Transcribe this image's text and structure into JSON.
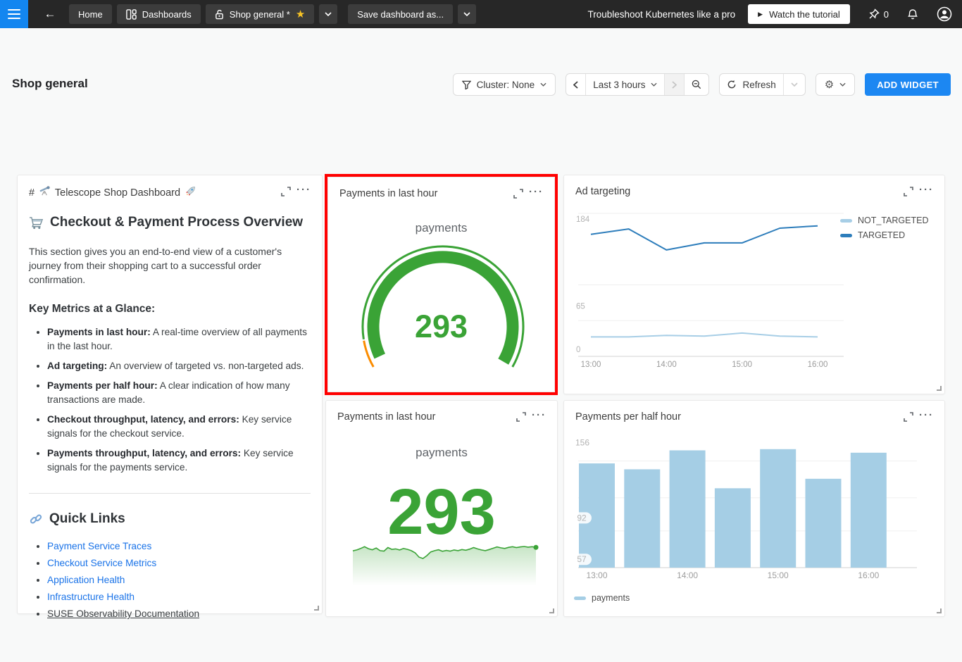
{
  "navbar": {
    "tabs": [
      {
        "label": "Home"
      },
      {
        "label": "Dashboards",
        "icon": "dashboards-icon"
      },
      {
        "label": "Shop general *",
        "icon": "lock-open-icon",
        "star_icon": "star-icon",
        "starred": true
      }
    ],
    "save_button_label": "Save dashboard as...",
    "promo_text": "Troubleshoot Kubernetes like a pro",
    "tutorial_button_label": "Watch the tutorial",
    "pin_count": "0",
    "accent_color": "#1386f0"
  },
  "header": {
    "title": "Shop general",
    "cluster_filter_label": "Cluster: None",
    "time_range_label": "Last 3 hours",
    "refresh_label": "Refresh",
    "add_widget_label": "ADD WIDGET",
    "add_widget_color": "#1c87f2"
  },
  "markdown_widget": {
    "title_hash": "#",
    "title_text": "Telescope Shop Dashboard",
    "title_icons": [
      "telescope-icon",
      "rocket-icon"
    ],
    "heading_icon": "cart-icon",
    "heading": "Checkout & Payment Process Overview",
    "intro": "This section gives you an end-to-end view of a customer's journey from their shopping cart to a successful order confirmation.",
    "metrics_heading": "Key Metrics at a Glance:",
    "metrics": [
      {
        "term": "Payments in last hour:",
        "desc": "A real-time overview of all payments in the last hour."
      },
      {
        "term": "Ad targeting:",
        "desc": "An overview of targeted vs. non-targeted ads."
      },
      {
        "term": "Payments per half hour:",
        "desc": "A clear indication of how many transactions are made."
      },
      {
        "term": "Checkout throughput, latency, and errors:",
        "desc": "Key service signals for the checkout service."
      },
      {
        "term": "Payments throughput, latency, and errors:",
        "desc": "Key service signals for the payments service."
      }
    ],
    "links_heading_icon": "link-icon",
    "links_heading": "Quick Links",
    "links": [
      {
        "label": "Payment Service Traces",
        "style": "link"
      },
      {
        "label": "Checkout Service Metrics",
        "style": "link"
      },
      {
        "label": "Application Health",
        "style": "link"
      },
      {
        "label": "Infrastructure Health",
        "style": "link"
      },
      {
        "label": "SUSE Observability Documentation",
        "style": "plain-underline"
      }
    ]
  },
  "annotation": {
    "type": "highlight-box",
    "color": "#ff0000",
    "target": "Payments in last hour gauge widget"
  },
  "chart_data": [
    {
      "id": "gauge-payments",
      "type": "gauge",
      "widget_title": "Payments in last hour",
      "series_label": "payments",
      "value": 293,
      "value_display": "293",
      "gauge_color": "#3aa336",
      "threshold_color": "#fb8c00",
      "sweep_deg": 240,
      "threshold_sweep_deg": 20
    },
    {
      "id": "ad-targeting",
      "type": "line",
      "title": "Ad targeting",
      "x": [
        "13:00",
        "13:30",
        "14:00",
        "14:30",
        "15:00",
        "15:30",
        "16:00"
      ],
      "x_tick_labels": [
        "13:00",
        "14:00",
        "15:00",
        "16:00"
      ],
      "series": [
        {
          "name": "NOT_TARGETED",
          "color": "#a7cee6",
          "values": [
            25,
            25,
            27,
            26,
            30,
            26,
            25
          ]
        },
        {
          "name": "TARGETED",
          "color": "#2d7dbb",
          "values": [
            157,
            164,
            137,
            146,
            146,
            165,
            168
          ]
        }
      ],
      "ylim": [
        0,
        184
      ],
      "yticks": [
        184,
        65,
        0
      ],
      "gridline_values": [
        184,
        92,
        46
      ],
      "legend_position": "right",
      "grid": true
    },
    {
      "id": "payments-number",
      "type": "number+sparkline",
      "widget_title": "Payments in last hour",
      "series_label": "payments",
      "value": 293,
      "value_display": "293",
      "color": "#3aa336",
      "sparkline": [
        291.2,
        291.6,
        292.3,
        293.1,
        292.2,
        291.7,
        292.5,
        291.3,
        291.1,
        292.7,
        291.9,
        292.1,
        291.6,
        292.3,
        291.9,
        291.3,
        290.3,
        288.3,
        287.7,
        289.0,
        290.7,
        291.3,
        291.7,
        291.0,
        291.4,
        291.1,
        291.6,
        291.3,
        291.8,
        291.5,
        292.0,
        292.7,
        292.1,
        291.6,
        291.3,
        291.8,
        292.4,
        293.0,
        292.6,
        292.3,
        292.8,
        293.1,
        292.7,
        293.0,
        293.2,
        292.9,
        293.1,
        292.8
      ]
    },
    {
      "id": "payments-per-half-hour",
      "type": "bar",
      "title": "Payments per half hour",
      "categories": [
        "13:00",
        "13:30",
        "14:00",
        "14:30",
        "15:00",
        "15:30",
        "16:00"
      ],
      "values": [
        138,
        133,
        149,
        117,
        150,
        125,
        147
      ],
      "x_tick_labels": [
        "13:00",
        "14:00",
        "15:00",
        "16:00"
      ],
      "bar_color": "#a5cee5",
      "ylim": [
        50,
        157
      ],
      "yticks": [
        156,
        92,
        57
      ],
      "gridline_values": [
        140,
        109,
        81
      ],
      "legend": [
        "payments"
      ],
      "legend_position": "bottom",
      "grid": true
    }
  ]
}
